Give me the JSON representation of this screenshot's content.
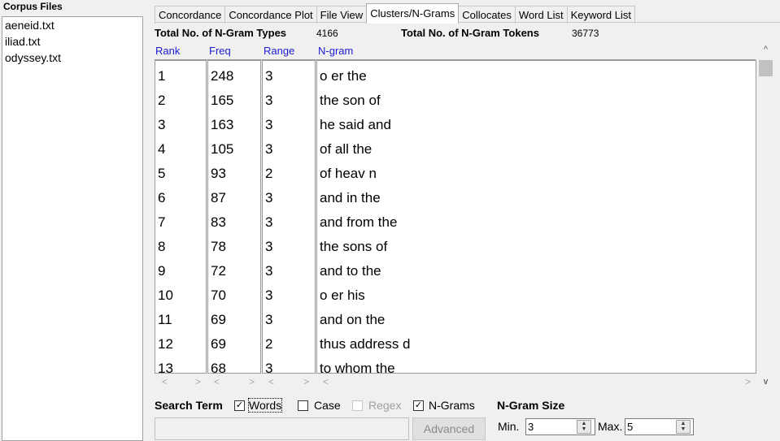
{
  "corpus": {
    "title": "Corpus Files",
    "files": [
      "aeneid.txt",
      "iliad.txt",
      "odyssey.txt"
    ]
  },
  "tabs": [
    {
      "label": "Concordance",
      "active": false
    },
    {
      "label": "Concordance Plot",
      "active": false
    },
    {
      "label": "File View",
      "active": false
    },
    {
      "label": "Clusters/N-Grams",
      "active": true
    },
    {
      "label": "Collocates",
      "active": false
    },
    {
      "label": "Word List",
      "active": false
    },
    {
      "label": "Keyword List",
      "active": false
    }
  ],
  "stats": {
    "types_label": "Total No. of N-Gram Types",
    "types_value": "4166",
    "tokens_label": "Total No. of N-Gram Tokens",
    "tokens_value": "36773"
  },
  "columns": {
    "rank": "Rank",
    "freq": "Freq",
    "range": "Range",
    "ngram": "N-gram"
  },
  "rows": [
    {
      "rank": "1",
      "freq": "248",
      "range": "3",
      "ngram": "o er the"
    },
    {
      "rank": "2",
      "freq": "165",
      "range": "3",
      "ngram": "the son of"
    },
    {
      "rank": "3",
      "freq": "163",
      "range": "3",
      "ngram": "he said and"
    },
    {
      "rank": "4",
      "freq": "105",
      "range": "3",
      "ngram": "of all the"
    },
    {
      "rank": "5",
      "freq": "93",
      "range": "2",
      "ngram": "of heav n"
    },
    {
      "rank": "6",
      "freq": "87",
      "range": "3",
      "ngram": "and in the"
    },
    {
      "rank": "7",
      "freq": "83",
      "range": "3",
      "ngram": "and from the"
    },
    {
      "rank": "8",
      "freq": "78",
      "range": "3",
      "ngram": "the sons of"
    },
    {
      "rank": "9",
      "freq": "72",
      "range": "3",
      "ngram": "and to the"
    },
    {
      "rank": "10",
      "freq": "70",
      "range": "3",
      "ngram": "o er his"
    },
    {
      "rank": "11",
      "freq": "69",
      "range": "3",
      "ngram": "and on the"
    },
    {
      "rank": "12",
      "freq": "69",
      "range": "2",
      "ngram": "thus address d"
    },
    {
      "rank": "13",
      "freq": "68",
      "range": "3",
      "ngram": "to whom the"
    }
  ],
  "search": {
    "label": "Search Term",
    "words_label": "Words",
    "words_checked": true,
    "case_label": "Case",
    "case_checked": false,
    "regex_label": "Regex",
    "regex_checked": false,
    "ngrams_label": "N-Grams",
    "ngrams_checked": true,
    "input_value": "",
    "advanced_label": "Advanced"
  },
  "ngram_size": {
    "label": "N-Gram Size",
    "min_label": "Min.",
    "min_value": "3",
    "max_label": "Max.",
    "max_value": "5"
  },
  "icons": {
    "check": "✓",
    "scroll_up": "^",
    "scroll_down": "v",
    "scroll_left": "<",
    "scroll_right": ">",
    "spin_up": "▲",
    "spin_down": "▼"
  }
}
